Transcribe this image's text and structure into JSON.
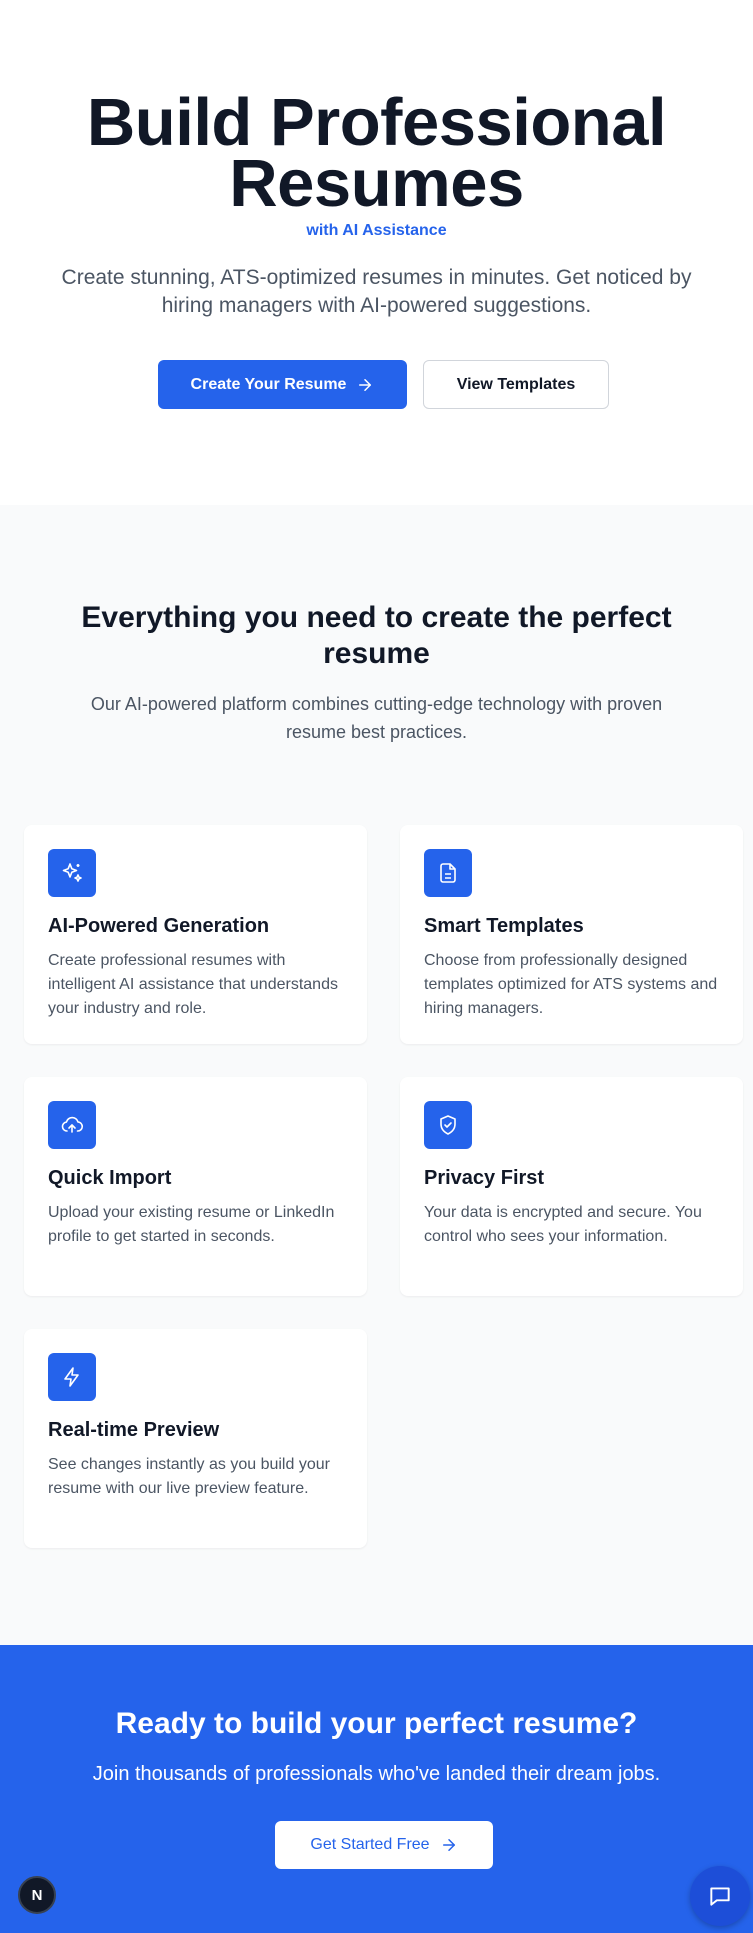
{
  "hero": {
    "title": "Build Professional Resumes",
    "subtitle": "with AI Assistance",
    "description": "Create stunning, ATS-optimized resumes in minutes. Get noticed by hiring managers with AI-powered suggestions.",
    "primary_button": "Create Your Resume",
    "secondary_button": "View Templates"
  },
  "features": {
    "title": "Everything you need to create the perfect resume",
    "description": "Our AI-powered platform combines cutting-edge technology with proven resume best practices.",
    "items": [
      {
        "icon": "sparkles-icon",
        "title": "AI-Powered Generation",
        "description": "Create professional resumes with intelligent AI assistance that understands your industry and role."
      },
      {
        "icon": "document-icon",
        "title": "Smart Templates",
        "description": "Choose from professionally designed templates optimized for ATS systems and hiring managers."
      },
      {
        "icon": "cloud-upload-icon",
        "title": "Quick Import",
        "description": "Upload your existing resume or LinkedIn profile to get started in seconds."
      },
      {
        "icon": "shield-check-icon",
        "title": "Privacy First",
        "description": "Your data is encrypted and secure. You control who sees your information."
      },
      {
        "icon": "lightning-icon",
        "title": "Real-time Preview",
        "description": "See changes instantly as you build your resume with our live preview feature."
      }
    ]
  },
  "cta": {
    "title": "Ready to build your perfect resume?",
    "description": "Join thousands of professionals who've landed their dream jobs.",
    "button": "Get Started Free"
  },
  "badge": {
    "label": "N"
  },
  "colors": {
    "accent": "#2563eb",
    "text_dark": "#111827",
    "text_muted": "#4b5563",
    "section_bg": "#f9fafb"
  }
}
